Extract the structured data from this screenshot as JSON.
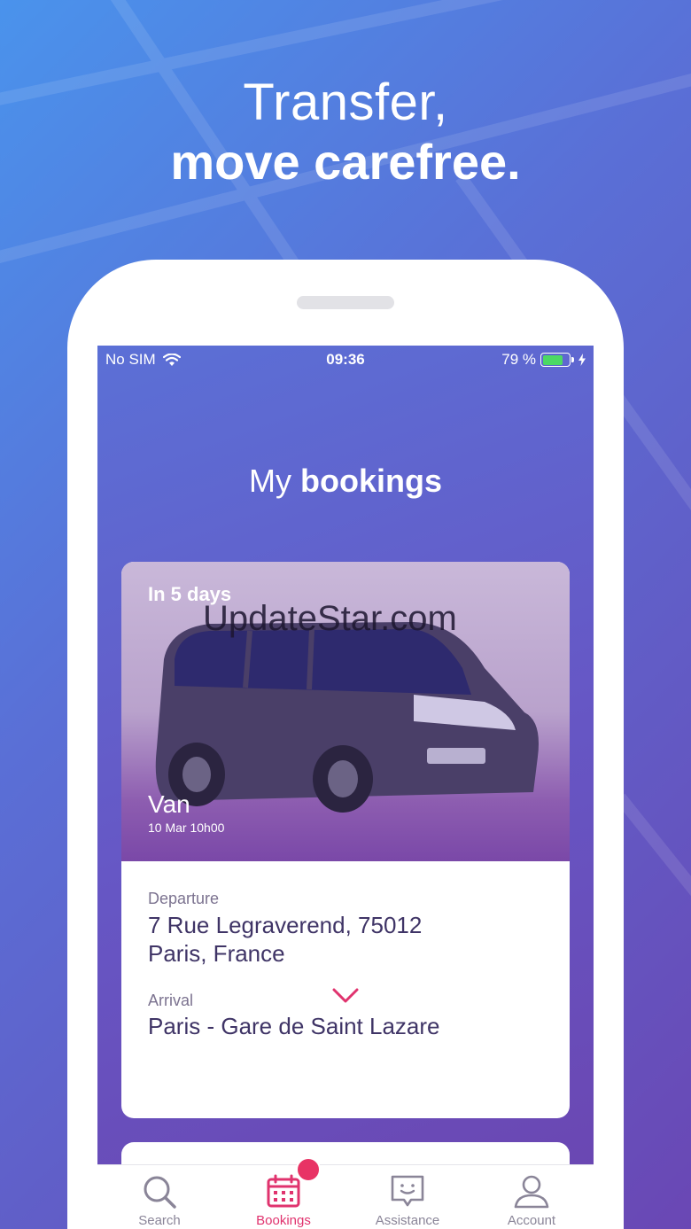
{
  "promo": {
    "headline_line1": "Transfer,",
    "headline_line2": "move carefree."
  },
  "status_bar": {
    "carrier": "No SIM",
    "time": "09:36",
    "battery": "79 %",
    "battery_level": 0.79
  },
  "screen": {
    "title_light": "My",
    "title_bold": "bookings"
  },
  "booking": {
    "when": "In 5 days",
    "watermark": "UpdateStar.com",
    "vehicle_type": "Van",
    "datetime": "10 Mar 10h00",
    "departure_label": "Departure",
    "departure_line1": "7 Rue Legraverend, 75012",
    "departure_line2": "Paris, France",
    "arrival_label": "Arrival",
    "arrival_value": "Paris - Gare de Saint Lazare"
  },
  "tabs": [
    {
      "label": "Search",
      "icon": "search-icon",
      "active": false
    },
    {
      "label": "Bookings",
      "icon": "calendar-icon",
      "active": true
    },
    {
      "label": "Assistance",
      "icon": "chat-icon",
      "active": false
    },
    {
      "label": "Account",
      "icon": "user-icon",
      "active": false
    }
  ],
  "colors": {
    "accent": "#e0336e",
    "badge": "#e83365",
    "battery": "#4cd964",
    "text_dark": "#3f3466"
  }
}
